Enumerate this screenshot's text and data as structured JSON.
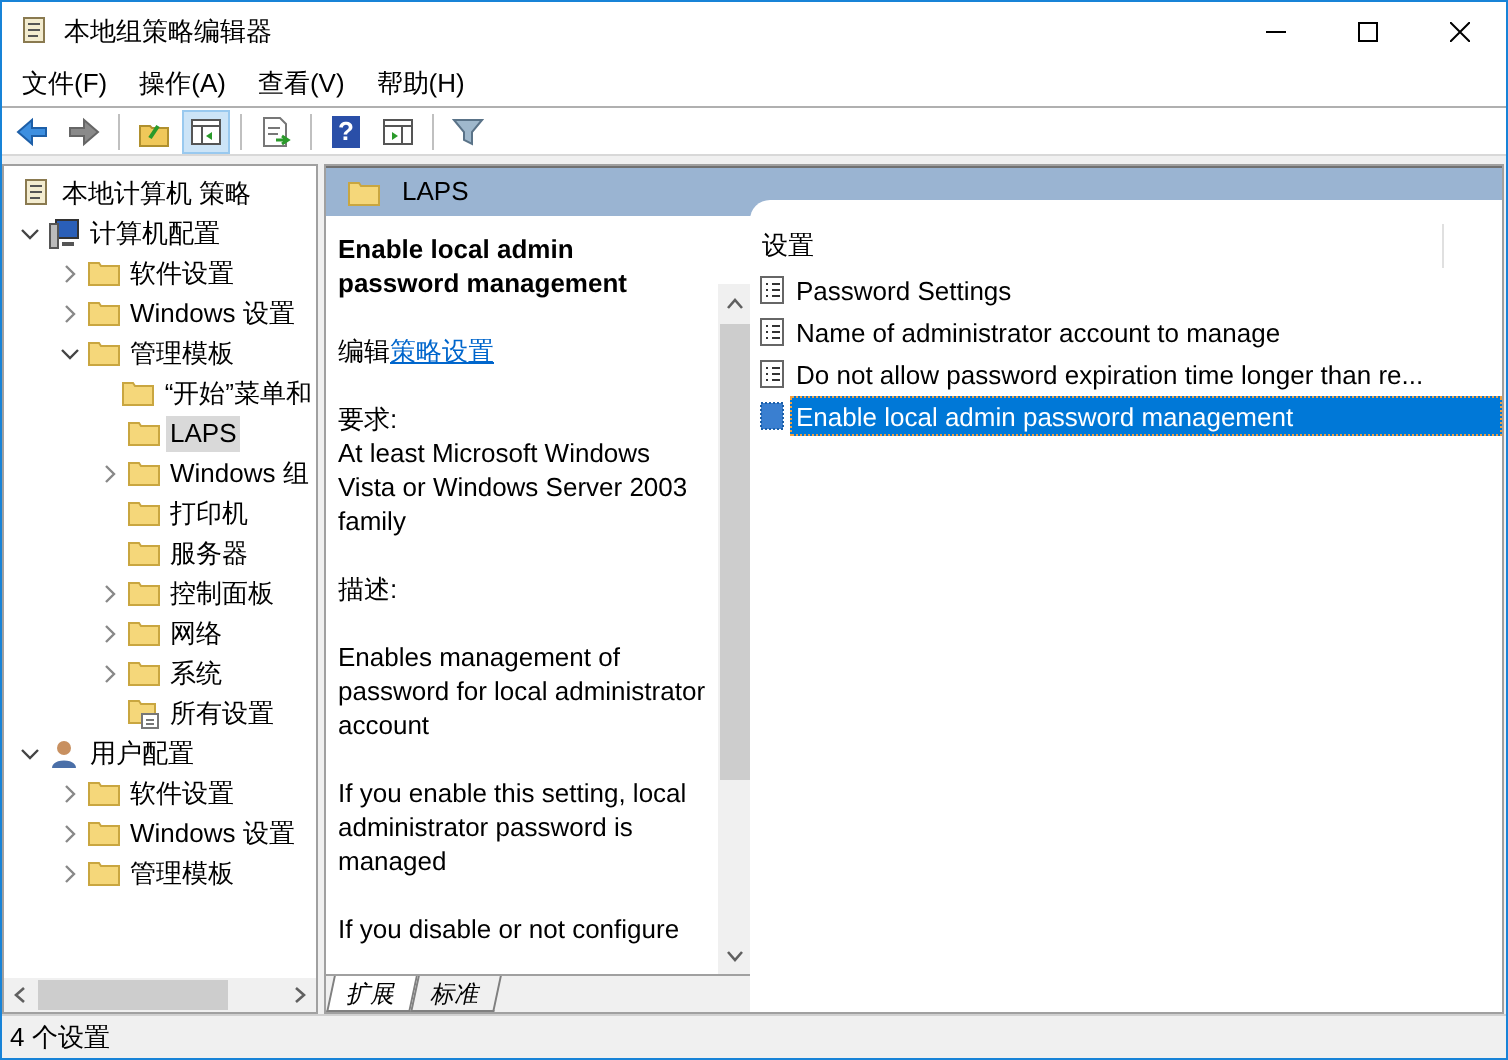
{
  "window": {
    "title": "本地组策略编辑器"
  },
  "menu": [
    "文件(F)",
    "操作(A)",
    "查看(V)",
    "帮助(H)"
  ],
  "toolbar": [
    {
      "kind": "back",
      "pressed": false
    },
    {
      "kind": "forward",
      "pressed": false
    },
    {
      "kind": "sep"
    },
    {
      "kind": "up",
      "pressed": false
    },
    {
      "kind": "tree",
      "pressed": true
    },
    {
      "kind": "sep"
    },
    {
      "kind": "export",
      "pressed": false
    },
    {
      "kind": "sep"
    },
    {
      "kind": "help",
      "label": "?",
      "pressed": false
    },
    {
      "kind": "pane",
      "pressed": false
    },
    {
      "kind": "sep"
    },
    {
      "kind": "filter",
      "pressed": false
    }
  ],
  "tree": [
    {
      "label": "本地计算机 策略",
      "kind": "policy",
      "selected": false,
      "children": [
        {
          "label": "计算机配置",
          "kind": "computer",
          "expanded": true,
          "selected": false,
          "children": [
            {
              "label": "软件设置",
              "kind": "folder",
              "expanded": false,
              "selected": false
            },
            {
              "label": "Windows 设置",
              "kind": "folder",
              "expanded": false,
              "selected": false
            },
            {
              "label": "管理模板",
              "kind": "folder",
              "expanded": true,
              "selected": false,
              "children": [
                {
                  "label": "“开始”菜单和",
                  "kind": "folder",
                  "selected": false
                },
                {
                  "label": "LAPS",
                  "kind": "folder",
                  "selected": true
                },
                {
                  "label": "Windows 组",
                  "kind": "folder",
                  "expanded": false,
                  "selected": false
                },
                {
                  "label": "打印机",
                  "kind": "folder",
                  "selected": false
                },
                {
                  "label": "服务器",
                  "kind": "folder",
                  "selected": false
                },
                {
                  "label": "控制面板",
                  "kind": "folder",
                  "expanded": false,
                  "selected": false
                },
                {
                  "label": "网络",
                  "kind": "folder",
                  "expanded": false,
                  "selected": false
                },
                {
                  "label": "系统",
                  "kind": "folder",
                  "expanded": false,
                  "selected": false
                },
                {
                  "label": "所有设置",
                  "kind": "allsettings",
                  "selected": false
                }
              ]
            }
          ]
        },
        {
          "label": "用户配置",
          "kind": "user",
          "expanded": true,
          "selected": false,
          "children": [
            {
              "label": "软件设置",
              "kind": "folder",
              "expanded": false,
              "selected": false
            },
            {
              "label": "Windows 设置",
              "kind": "folder",
              "expanded": false,
              "selected": false
            },
            {
              "label": "管理模板",
              "kind": "folder",
              "expanded": false,
              "selected": false
            }
          ]
        }
      ]
    }
  ],
  "header": {
    "title": "LAPS"
  },
  "description": {
    "title": "Enable local admin password management",
    "edit_prefix": "编辑",
    "edit_link": "策略设置",
    "paragraphs": [
      "要求:\nAt least Microsoft Windows Vista or Windows Server 2003 family",
      "描述:",
      "Enables management of password for local administrator account",
      "If you enable this setting, local administrator password is managed",
      "If you disable or not configure"
    ]
  },
  "list": {
    "column": "设置",
    "rows": [
      {
        "label": "Password Settings",
        "selected": false
      },
      {
        "label": "Name of administrator account to manage",
        "selected": false
      },
      {
        "label": "Do not allow password expiration time longer than re...",
        "selected": false
      },
      {
        "label": "Enable local admin password management",
        "selected": true
      }
    ]
  },
  "tabs": [
    {
      "label": "扩展",
      "selected": true
    },
    {
      "label": "标准",
      "selected": false
    }
  ],
  "status_bar": "4 个设置"
}
